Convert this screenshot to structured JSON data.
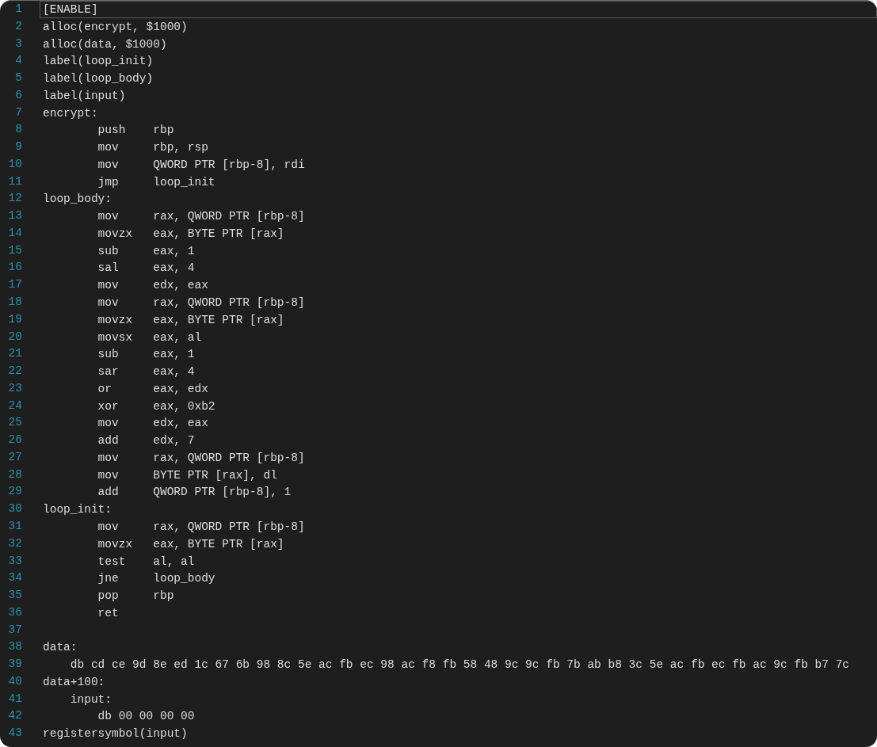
{
  "editor": {
    "lines": [
      {
        "number": "1",
        "text": "[ENABLE]",
        "current": true
      },
      {
        "number": "2",
        "text": "alloc(encrypt, $1000)",
        "current": false
      },
      {
        "number": "3",
        "text": "alloc(data, $1000)",
        "current": false
      },
      {
        "number": "4",
        "text": "label(loop_init)",
        "current": false
      },
      {
        "number": "5",
        "text": "label(loop_body)",
        "current": false
      },
      {
        "number": "6",
        "text": "label(input)",
        "current": false
      },
      {
        "number": "7",
        "text": "encrypt:",
        "current": false
      },
      {
        "number": "8",
        "text": "        push    rbp",
        "current": false
      },
      {
        "number": "9",
        "text": "        mov     rbp, rsp",
        "current": false
      },
      {
        "number": "10",
        "text": "        mov     QWORD PTR [rbp-8], rdi",
        "current": false
      },
      {
        "number": "11",
        "text": "        jmp     loop_init",
        "current": false
      },
      {
        "number": "12",
        "text": "loop_body:",
        "current": false
      },
      {
        "number": "13",
        "text": "        mov     rax, QWORD PTR [rbp-8]",
        "current": false
      },
      {
        "number": "14",
        "text": "        movzx   eax, BYTE PTR [rax]",
        "current": false
      },
      {
        "number": "15",
        "text": "        sub     eax, 1",
        "current": false
      },
      {
        "number": "16",
        "text": "        sal     eax, 4",
        "current": false
      },
      {
        "number": "17",
        "text": "        mov     edx, eax",
        "current": false
      },
      {
        "number": "18",
        "text": "        mov     rax, QWORD PTR [rbp-8]",
        "current": false
      },
      {
        "number": "19",
        "text": "        movzx   eax, BYTE PTR [rax]",
        "current": false
      },
      {
        "number": "20",
        "text": "        movsx   eax, al",
        "current": false
      },
      {
        "number": "21",
        "text": "        sub     eax, 1",
        "current": false
      },
      {
        "number": "22",
        "text": "        sar     eax, 4",
        "current": false
      },
      {
        "number": "23",
        "text": "        or      eax, edx",
        "current": false
      },
      {
        "number": "24",
        "text": "        xor     eax, 0xb2",
        "current": false
      },
      {
        "number": "25",
        "text": "        mov     edx, eax",
        "current": false
      },
      {
        "number": "26",
        "text": "        add     edx, 7",
        "current": false
      },
      {
        "number": "27",
        "text": "        mov     rax, QWORD PTR [rbp-8]",
        "current": false
      },
      {
        "number": "28",
        "text": "        mov     BYTE PTR [rax], dl",
        "current": false
      },
      {
        "number": "29",
        "text": "        add     QWORD PTR [rbp-8], 1",
        "current": false
      },
      {
        "number": "30",
        "text": "loop_init:",
        "current": false
      },
      {
        "number": "31",
        "text": "        mov     rax, QWORD PTR [rbp-8]",
        "current": false
      },
      {
        "number": "32",
        "text": "        movzx   eax, BYTE PTR [rax]",
        "current": false
      },
      {
        "number": "33",
        "text": "        test    al, al",
        "current": false
      },
      {
        "number": "34",
        "text": "        jne     loop_body",
        "current": false
      },
      {
        "number": "35",
        "text": "        pop     rbp",
        "current": false
      },
      {
        "number": "36",
        "text": "        ret",
        "current": false
      },
      {
        "number": "37",
        "current": false
      },
      {
        "number": "38",
        "text": "data:",
        "current": false
      },
      {
        "number": "39",
        "text": "    db cd ce 9d 8e ed 1c 67 6b 98 8c 5e ac fb ec 98 ac f8 fb 58 48 9c 9c fb 7b ab b8 3c 5e ac fb ec fb ac 9c fb b7 7c",
        "current": false
      },
      {
        "number": "40",
        "text": "data+100:",
        "current": false
      },
      {
        "number": "41",
        "text": "    input:",
        "current": false
      },
      {
        "number": "42",
        "text": "        db 00 00 00 00",
        "current": false
      },
      {
        "number": "43",
        "text": "registersymbol(input)",
        "current": false
      }
    ]
  }
}
